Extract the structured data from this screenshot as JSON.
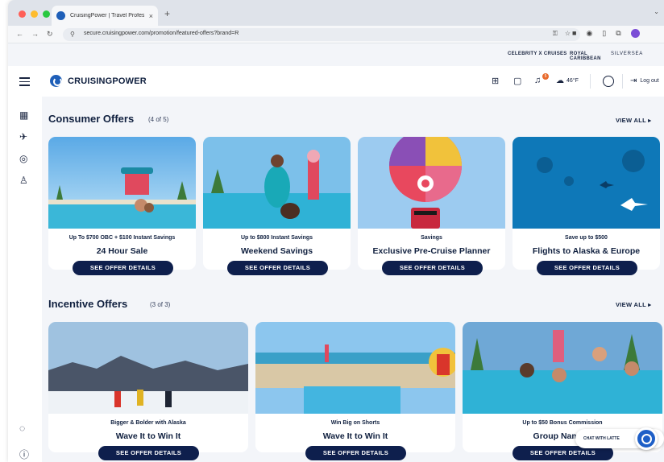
{
  "browser": {
    "tab_title": "CruisingPower | Travel Profes",
    "tab_close": "×",
    "new_tab": "+",
    "url": "secure.cruisingpower.com/promotion/featured-offers?brand=R"
  },
  "brands": [
    "CELEBRITY X CRUISES",
    "ROYAL CARIBBEAN",
    "SILVERSEA"
  ],
  "header": {
    "logo_text": "CRUISINGPOWER",
    "notification_count": "5",
    "weather": "46°F",
    "logout_label": "Log out"
  },
  "consumer": {
    "title": "Consumer Offers",
    "count": "(4 of 5)",
    "view_all": "VIEW ALL",
    "cards": [
      {
        "subtitle": "Up To $700 OBC + $100 Instant Savings",
        "title": "24 Hour Sale",
        "button": "SEE OFFER DETAILS"
      },
      {
        "subtitle": "Up to $800 Instant Savings",
        "title": "Weekend Savings",
        "button": "SEE OFFER DETAILS"
      },
      {
        "subtitle": "Savings",
        "title": "Exclusive Pre-Cruise Planner",
        "button": "SEE OFFER DETAILS"
      },
      {
        "subtitle": "Save up to $500",
        "title": "Flights to Alaska & Europe",
        "button": "SEE OFFER DETAILS"
      }
    ]
  },
  "incentive": {
    "title": "Incentive Offers",
    "count": "(3 of 3)",
    "view_all": "VIEW ALL",
    "cards": [
      {
        "subtitle": "Bigger & Bolder with Alaska",
        "title": "Wave It to Win It",
        "button": "SEE OFFER DETAILS"
      },
      {
        "subtitle": "Win Big on Shorts",
        "title": "Wave It to Win It",
        "button": "SEE OFFER DETAILS"
      },
      {
        "subtitle": "Up to $50 Bonus Commission",
        "title": "Group Naming",
        "button": "SEE OFFER DETAILS"
      }
    ]
  },
  "chat": {
    "label": "CHAT WITH LATTE"
  },
  "colors": {
    "navy": "#0e1f4d",
    "brand_blue": "#1f5fb8",
    "background": "#f3f5f9"
  }
}
